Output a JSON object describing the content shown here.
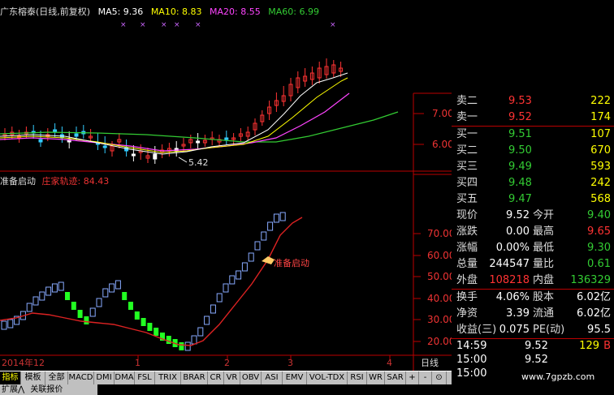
{
  "header": {
    "title": "广东榕泰(日线,前复权)",
    "ma5": "MA5: 9.36",
    "ma10": "MA10: 8.83",
    "ma20": "MA20: 8.55",
    "ma60": "MA60: 6.99",
    "colors": {
      "ma5": "#ffffff",
      "ma10": "#ffff00",
      "ma20": "#ff44ff",
      "ma60": "#33cc33"
    }
  },
  "price_chart": {
    "low_marker": "5.42",
    "y_ticks": [
      "7.00",
      "6.00"
    ]
  },
  "indicator": {
    "name": "准备启动",
    "value_label": "庄家轨迹: 84.43",
    "signal_label": "准备启动",
    "y_ticks": [
      "70.00",
      "60.00",
      "50.00",
      "40.00",
      "30.00",
      "20.00"
    ]
  },
  "x_axis": {
    "labels": [
      "2014年12",
      "1",
      "2",
      "3",
      "4"
    ],
    "period": "日线"
  },
  "quote_panel": {
    "orders": [
      {
        "label": "卖二",
        "price": "9.53",
        "vol": "222"
      },
      {
        "label": "卖一",
        "price": "9.52",
        "vol": "174"
      },
      {
        "label": "买一",
        "price": "9.51",
        "vol": "107"
      },
      {
        "label": "买二",
        "price": "9.50",
        "vol": "670"
      },
      {
        "label": "买三",
        "price": "9.49",
        "vol": "593"
      },
      {
        "label": "买四",
        "price": "9.48",
        "vol": "242"
      },
      {
        "label": "买五",
        "price": "9.47",
        "vol": "568"
      }
    ],
    "stats": [
      {
        "l1": "现价",
        "v1": "9.52",
        "l2": "今开",
        "v2": "9.40"
      },
      {
        "l1": "涨跌",
        "v1": "0.00",
        "l2": "最高",
        "v2": "9.65"
      },
      {
        "l1": "涨幅",
        "v1": "0.00%",
        "l2": "最低",
        "v2": "9.30"
      },
      {
        "l1": "总量",
        "v1": "244547",
        "l2": "量比",
        "v2": "0.61"
      },
      {
        "l1": "外盘",
        "v1": "108218",
        "l2": "内盘",
        "v2": "136329"
      },
      {
        "l1": "换手",
        "v1": "4.06%",
        "l2": "股本",
        "v2": "6.02亿"
      },
      {
        "l1": "净资",
        "v1": "3.39",
        "l2": "流通",
        "v2": "6.02亿"
      },
      {
        "l1": "收益(三)",
        "v1": "0.075",
        "l2": "PE(动)",
        "v2": "95.5"
      }
    ],
    "ticks": [
      {
        "time": "14:59",
        "price": "9.52",
        "vol": "129",
        "dir": "B"
      },
      {
        "time": "15:00",
        "price": "9.52",
        "vol": "",
        "dir": ""
      },
      {
        "time": "15:00",
        "price": "",
        "vol": "",
        "dir": ""
      }
    ]
  },
  "tabs": [
    "指标",
    "模板",
    "全部",
    "MACD",
    "DMI",
    "DMA",
    "FSL",
    "TRIX",
    "BRAR",
    "CR",
    "VR",
    "OBV",
    "ASI",
    "EMV",
    "VOL-TDX",
    "RSI",
    "WR",
    "SAR",
    "+",
    "-",
    "⊙"
  ],
  "status": [
    "扩展⋀",
    "关联报价"
  ],
  "watermark": "www.7gpzb.com"
}
